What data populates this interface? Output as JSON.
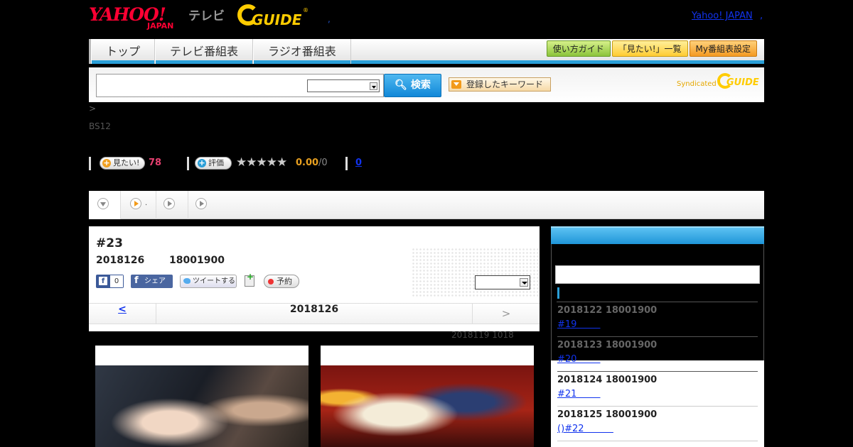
{
  "header": {
    "logo_main": "YAHOO!",
    "logo_japan": "JAPAN",
    "logo_tv": "テレビ",
    "logo_gguide": "GUIDE",
    "logo_reg": "®",
    "dot": ",",
    "yahoo_link": "Yahoo! JAPAN",
    "yahoo_link_suffix": ","
  },
  "nav": {
    "tabs": [
      "トップ",
      "テレビ番組表",
      "ラジオ番組表"
    ],
    "buttons": [
      "使い方ガイド",
      "「見たい!」一覧",
      "My番組表設定"
    ]
  },
  "search": {
    "query": "",
    "select_value": "",
    "button_label": "検索",
    "keyword_button": "登録したキーワード",
    "syndicated": "Syndicated",
    "syndicated_logo": "GUIDE"
  },
  "breadcrumb": ">",
  "channel": "BS12",
  "ratings": {
    "want_label": "見たい!",
    "want_count": "78",
    "rate_label": "評価",
    "stars": "★★★★★",
    "score": "0.00",
    "score_total": "/0",
    "reviews": "0"
  },
  "tabs": {
    "dot_label": "."
  },
  "episode": {
    "title": "#23",
    "date": "2018126",
    "time": "18001900",
    "fb_like_count": "0",
    "fb_share": "シェア",
    "tweet": "ツイートする",
    "reserve": "予約",
    "select_value": "",
    "pager_prev": "<",
    "pager_current": "2018126",
    "pager_next": ">",
    "updated": "2018119  1018"
  },
  "sidebar": {
    "items": [
      {
        "date": "2018122  18001900",
        "link": "#19        "
      },
      {
        "date": "2018123  18001900",
        "link": "#20        "
      },
      {
        "date": "2018124  18001900",
        "link": "#21        "
      },
      {
        "date": "2018125  18001900",
        "link": "()#22          "
      }
    ]
  },
  "colors": {
    "accent_blue": "#2a9fd8",
    "link_blue": "#1133ee",
    "yahoo_red": "#ff0033",
    "gguide_yellow": "#ffcc00",
    "want_pink": "#e64070",
    "score_orange": "#e8a020"
  }
}
